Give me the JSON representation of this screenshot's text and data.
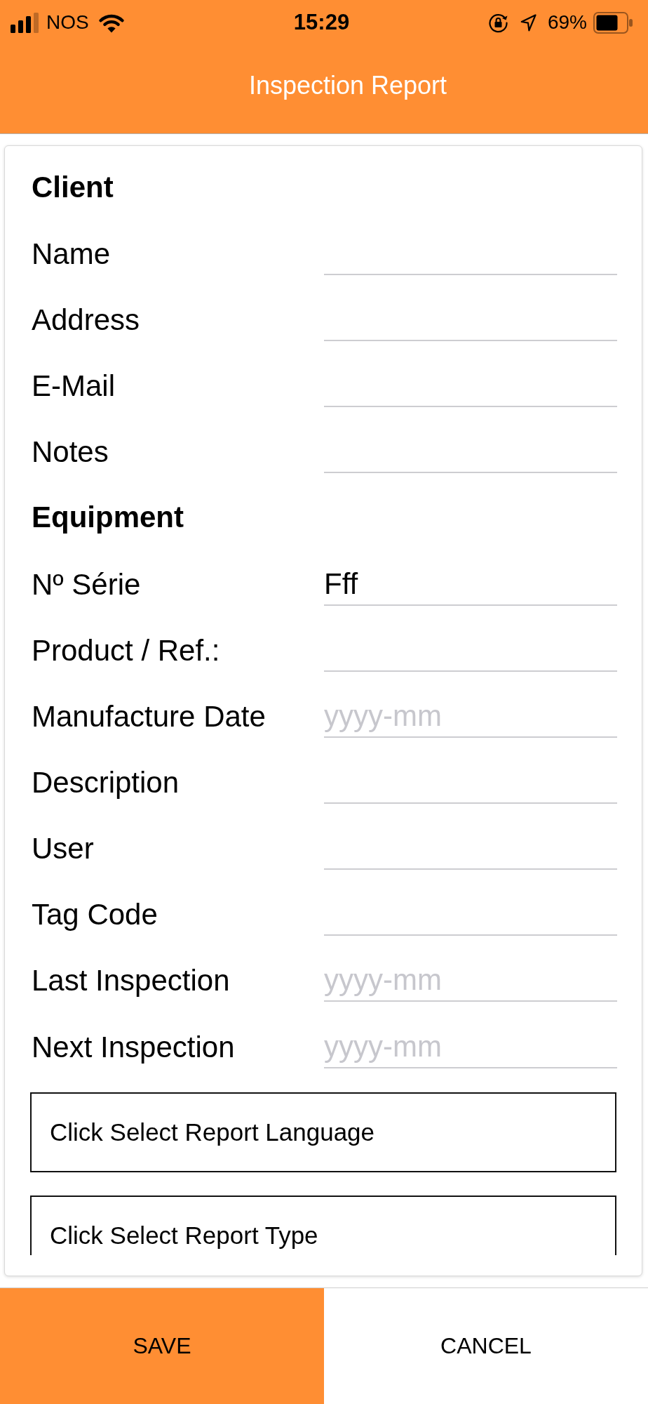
{
  "status_bar": {
    "carrier": "NOS",
    "time": "15:29",
    "battery": "69%"
  },
  "header": {
    "title": "Inspection Report"
  },
  "form": {
    "sections": [
      {
        "title": "Client",
        "fields": [
          {
            "label": "Name"
          },
          {
            "label": "Address"
          },
          {
            "label": "E-Mail"
          },
          {
            "label": "Notes"
          }
        ]
      },
      {
        "title": "Equipment",
        "fields": [
          {
            "label": "Nº Série",
            "value": "Fff"
          },
          {
            "label": "Product / Ref.:"
          },
          {
            "label": "Manufacture Date",
            "placeholder": "yyyy-mm"
          },
          {
            "label": "Description"
          },
          {
            "label": "User"
          },
          {
            "label": "Tag Code"
          },
          {
            "label": "Last Inspection",
            "placeholder": "yyyy-mm"
          },
          {
            "label": "Next Inspection",
            "placeholder": "yyyy-mm"
          }
        ]
      }
    ],
    "pickers": [
      {
        "text": "Click Select Report Language"
      },
      {
        "text": "Click Select Report Type"
      }
    ]
  },
  "actions": [
    {
      "label": "SAVE",
      "kind": "primary"
    },
    {
      "label": "CANCEL",
      "kind": "secondary"
    }
  ]
}
